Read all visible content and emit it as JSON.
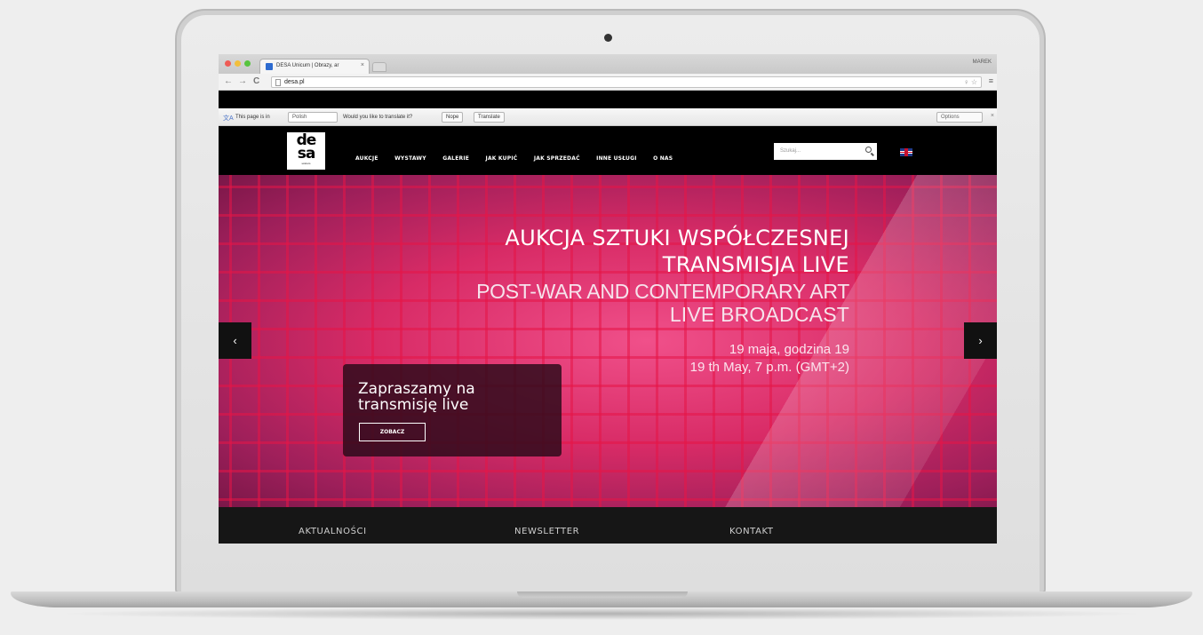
{
  "browser": {
    "tab_title": "DESA Unicum | Obrazy, ar",
    "tab_close": "×",
    "user": "MAREK",
    "url": "desa.pl",
    "back": "←",
    "forward": "→",
    "reload": "C",
    "omni_icons": "♀ ☆",
    "menu": "≡"
  },
  "translate_bar": {
    "prefix": "This page is in",
    "language": "Polish",
    "question": "Would you like to translate it?",
    "nope": "Nope",
    "translate": "Translate",
    "options": "Options",
    "close": "×"
  },
  "site": {
    "logo_line1": "de",
    "logo_line2": "sa",
    "logo_sub": "unicum",
    "nav": [
      "AUKCJE",
      "WYSTAWY",
      "GALERIE",
      "JAK KUPIĆ",
      "JAK SPRZEDAĆ",
      "INNE USŁUGI",
      "O NAS"
    ],
    "search_placeholder": "Szukaj...",
    "language_flag": "English"
  },
  "hero": {
    "line1": "AUKCJA SZTUKI WSPÓŁCZESNEJ",
    "line2": "TRANSMISJA LIVE",
    "line3": "POST-WAR AND CONTEMPORARY ART",
    "line4": "LIVE BROADCAST",
    "line5": "19 maja, godzina 19",
    "line6": "19 th May, 7 p.m. (GMT+2)",
    "prev": "‹",
    "next": "›",
    "promo_title": "Zapraszamy na transmisję live",
    "promo_button": "ZOBACZ"
  },
  "footer": {
    "links": [
      "AKTUALNOŚCI",
      "NEWSLETTER",
      "KONTAKT"
    ]
  }
}
